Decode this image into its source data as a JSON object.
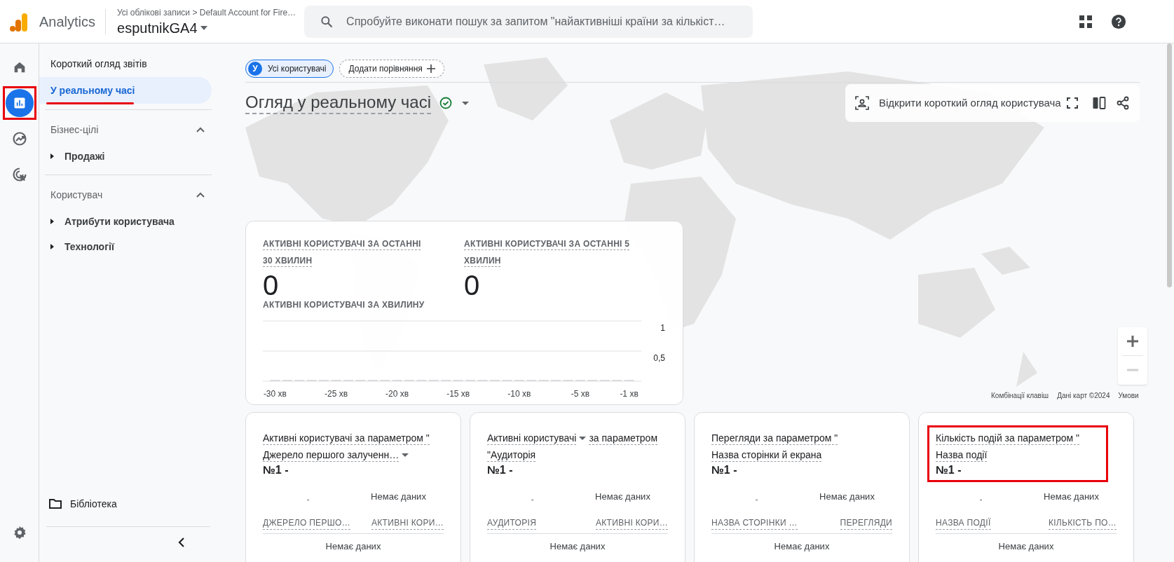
{
  "header": {
    "product": "Analytics",
    "breadcrumb": "Усі облікові записи > Default Account for Fire…",
    "property": "esputnikGA4",
    "search_placeholder": "Спробуйте виконати пошук за запитом \"найактивніші країни за кількіст…"
  },
  "rail": [
    {
      "kind": "home",
      "selected": false,
      "annotated": false
    },
    {
      "kind": "reports",
      "selected": true,
      "annotated": true
    },
    {
      "kind": "explore",
      "selected": false,
      "annotated": false
    },
    {
      "kind": "advertising",
      "selected": false,
      "annotated": false
    }
  ],
  "sidebar": {
    "items": [
      {
        "label": "Короткий огляд звітів",
        "selected": false,
        "annotated": false
      },
      {
        "label": "У реальному часі",
        "selected": true,
        "annotated": true
      }
    ],
    "sections": [
      {
        "title": "Бізнес-цілі",
        "expanded": true,
        "items": [
          {
            "label": "Продажі",
            "expanded": false
          }
        ]
      },
      {
        "title": "Користувач",
        "expanded": true,
        "items": [
          {
            "label": "Атрибути користувача",
            "expanded": false
          },
          {
            "label": "Технології",
            "expanded": false
          }
        ]
      }
    ],
    "library": "Бібліотека"
  },
  "comparisons": [
    {
      "avatar": "У",
      "label": "Усі користувачі"
    }
  ],
  "add_comparison": "Додати порівняння",
  "title": "Огляд у реальному часі",
  "user_snapshot": "Відкрити короткий огляд користувача",
  "map": {
    "kind": "picture",
    "attribution": [
      "Комбінації клавіш",
      "Дані карт ©2024",
      "Умови"
    ]
  },
  "realtime": {
    "stats": [
      {
        "label": "АКТИВНІ КОРИСТУВАЧІ ЗА ОСТАННІ 30 ХВИЛИН",
        "value": "0"
      },
      {
        "label": "АКТИВНІ КОРИСТУВАЧІ ЗА ОСТАННІ 5 ХВИЛИН",
        "value": "0"
      }
    ],
    "chart_label": "АКТИВНІ КОРИСТУВАЧІ ЗА ХВИЛИНУ",
    "chart_data": {
      "type": "bar",
      "x": [
        -30,
        -29,
        -28,
        -27,
        -26,
        -25,
        -24,
        -23,
        -22,
        -21,
        -20,
        -19,
        -18,
        -17,
        -16,
        -15,
        -14,
        -13,
        -12,
        -11,
        -10,
        -9,
        -8,
        -7,
        -6,
        -5,
        -4,
        -3,
        -2,
        -1
      ],
      "values": [
        0,
        0,
        0,
        0,
        0,
        0,
        0,
        0,
        0,
        0,
        0,
        0,
        0,
        0,
        0,
        0,
        0,
        0,
        0,
        0,
        0,
        0,
        0,
        0,
        0,
        0,
        0,
        0,
        0,
        0
      ],
      "xlim": [
        -31,
        0
      ],
      "ylim": [
        0,
        1
      ],
      "xticks": [
        {
          "value": -30,
          "label": "-30 хв"
        },
        {
          "value": -25,
          "label": "-25 хв"
        },
        {
          "value": -20,
          "label": "-20 хв"
        },
        {
          "value": -15,
          "label": "-15 хв"
        },
        {
          "value": -10,
          "label": "-10 хв"
        },
        {
          "value": -5,
          "label": "-5 хв"
        },
        {
          "value": -1,
          "label": "-1 хв"
        }
      ],
      "yticks": [
        {
          "value": 1,
          "label": "1"
        },
        {
          "value": 0.5,
          "label": "0,5"
        }
      ]
    }
  },
  "cards": [
    {
      "annotated": false,
      "lines": [
        [
          {
            "text": "Активні користувачі за параметром \"",
            "dropdown": false
          }
        ],
        [
          {
            "text": "Джерело першого залученн…",
            "dropdown": true
          }
        ]
      ],
      "rank": "№1 -",
      "mini_left": "-",
      "mini_right": "Немає даних",
      "columns": [
        "ДЖЕРЕЛО ПЕРШО…",
        "АКТИВНІ КОРИ…"
      ],
      "empty": "Немає даних"
    },
    {
      "annotated": false,
      "lines": [
        [
          {
            "text": "Активні користувачі",
            "dropdown": true
          },
          {
            "text": "за параметром",
            "dropdown": false
          }
        ],
        [
          {
            "text": "\"Аудиторія",
            "dropdown": false
          }
        ]
      ],
      "rank": "№1 -",
      "mini_left": "-",
      "mini_right": "Немає даних",
      "columns": [
        "АУДИТОРІЯ",
        "АКТИВНІ КОРИ…"
      ],
      "empty": "Немає даних"
    },
    {
      "annotated": false,
      "lines": [
        [
          {
            "text": "Перегляди за параметром \"",
            "dropdown": false
          }
        ],
        [
          {
            "text": "Назва сторінки й екрана",
            "dropdown": false
          }
        ]
      ],
      "rank": "№1 -",
      "mini_left": "-",
      "mini_right": "Немає даних",
      "columns": [
        "НАЗВА СТОРІНКИ …",
        "ПЕРЕГЛЯДИ"
      ],
      "empty": "Немає даних"
    },
    {
      "annotated": true,
      "lines": [
        [
          {
            "text": "Кількість подій за параметром \"",
            "dropdown": false
          }
        ],
        [
          {
            "text": "Назва події",
            "dropdown": false
          }
        ]
      ],
      "rank": "№1 -",
      "mini_left": "-",
      "mini_right": "Немає даних",
      "columns": [
        "НАЗВА ПОДІЇ",
        "КІЛЬКІСТЬ ПО…"
      ],
      "empty": "Немає даних"
    }
  ]
}
